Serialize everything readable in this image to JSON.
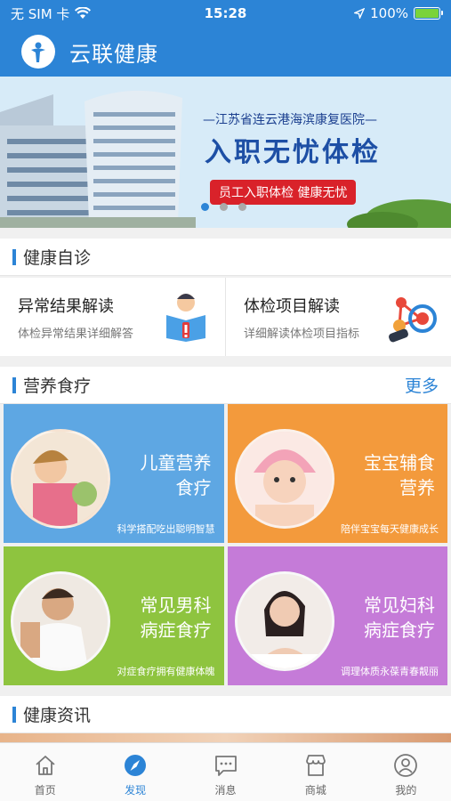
{
  "status": {
    "carrier": "无 SIM 卡",
    "time": "15:28",
    "battery": "100%"
  },
  "app": {
    "title": "云联健康"
  },
  "banner": {
    "subtitle": "—江苏省连云港海滨康复医院—",
    "title": "入职无忧体检",
    "tagline": "员工入职体检  健康无忧",
    "slides": 3,
    "active_slide": 0
  },
  "sections": {
    "self_diag": {
      "title": "健康自诊"
    },
    "nutrition": {
      "title": "营养食疗",
      "more": "更多"
    },
    "news": {
      "title": "健康资讯"
    }
  },
  "diag_items": [
    {
      "title": "异常结果解读",
      "subtitle": "体检异常结果详细解答"
    },
    {
      "title": "体检项目解读",
      "subtitle": "详细解读体检项目指标"
    }
  ],
  "tiles": [
    {
      "line1": "儿童营养",
      "line2": "食疗",
      "caption": "科学搭配吃出聪明智慧",
      "color": "#5ea7e3"
    },
    {
      "line1": "宝宝辅食",
      "line2": "营养",
      "caption": "陪伴宝宝每天健康成长",
      "color": "#f39a3c"
    },
    {
      "line1": "常见男科",
      "line2": "病症食疗",
      "caption": "对症食疗拥有健康体魄",
      "color": "#8ec43f"
    },
    {
      "line1": "常见妇科",
      "line2": "病症食疗",
      "caption": "调理体质永葆青春靓丽",
      "color": "#c57bd8"
    }
  ],
  "tabs": [
    {
      "label": "首页",
      "icon": "home-icon"
    },
    {
      "label": "发现",
      "icon": "compass-icon"
    },
    {
      "label": "消息",
      "icon": "message-icon"
    },
    {
      "label": "商城",
      "icon": "store-icon"
    },
    {
      "label": "我的",
      "icon": "profile-icon"
    }
  ],
  "active_tab": 1,
  "colors": {
    "primary": "#2c84d6"
  }
}
